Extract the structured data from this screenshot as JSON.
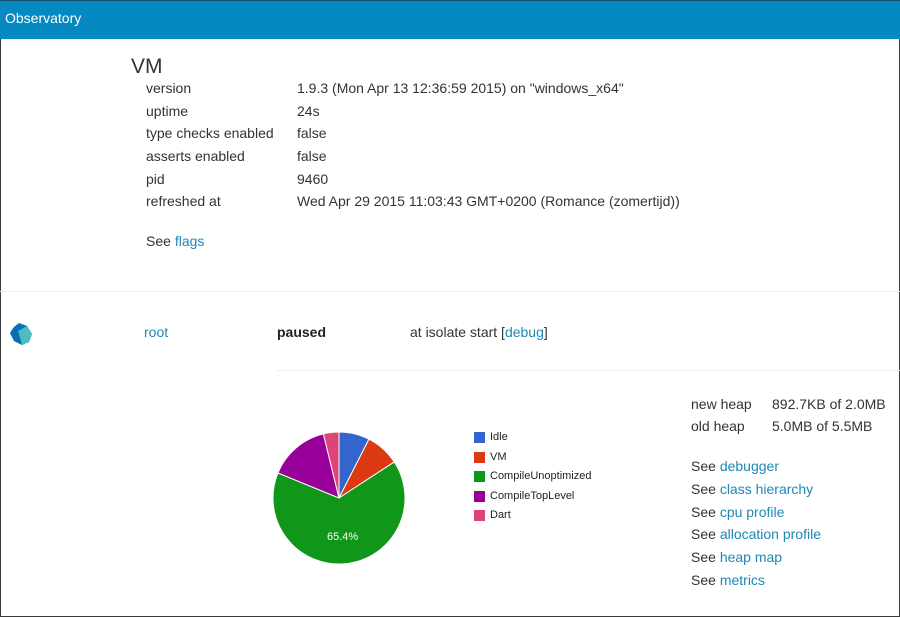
{
  "navbar": {
    "title": "Observatory"
  },
  "vm": {
    "title": "VM",
    "properties": [
      {
        "key": "version",
        "value": "1.9.3 (Mon Apr 13 12:36:59 2015) on \"windows_x64\""
      },
      {
        "key": "uptime",
        "value": "24s"
      },
      {
        "key": "type checks enabled",
        "value": "false"
      },
      {
        "key": "asserts enabled",
        "value": "false"
      },
      {
        "key": "pid",
        "value": "9460"
      },
      {
        "key": "refreshed at",
        "value": "Wed Apr 29 2015 11:03:43 GMT+0200 (Romance (zomertijd))"
      }
    ],
    "see_prefix": "See",
    "flags_link": "flags"
  },
  "isolate": {
    "icon": "dart-isolate-icon",
    "name": "root",
    "state": "paused",
    "detail_prefix": "at isolate start [",
    "debug_link": "debug",
    "detail_suffix": "]",
    "heap": [
      {
        "key": "new heap",
        "value": "892.7KB of 2.0MB"
      },
      {
        "key": "old heap",
        "value": "5.0MB of 5.5MB"
      }
    ],
    "links": [
      {
        "prefix": "See",
        "label": "debugger"
      },
      {
        "prefix": "See",
        "label": "class hierarchy"
      },
      {
        "prefix": "See",
        "label": "cpu profile"
      },
      {
        "prefix": "See",
        "label": "allocation profile"
      },
      {
        "prefix": "See",
        "label": "heap map"
      },
      {
        "prefix": "See",
        "label": "metrics"
      }
    ]
  },
  "chart_data": {
    "type": "pie",
    "title": "",
    "legend_position": "right",
    "categories": [
      "Idle",
      "VM",
      "CompileUnoptimized",
      "CompileTopLevel",
      "Dart"
    ],
    "values": [
      7.5,
      8.3,
      65.4,
      15.0,
      3.8
    ],
    "colors": [
      "#3366cc",
      "#dc3912",
      "#109618",
      "#990099",
      "#dd4477"
    ],
    "slice_labels": [
      "",
      "",
      "65.4%",
      "",
      ""
    ],
    "start_angle": "12 o'clock, clockwise"
  }
}
